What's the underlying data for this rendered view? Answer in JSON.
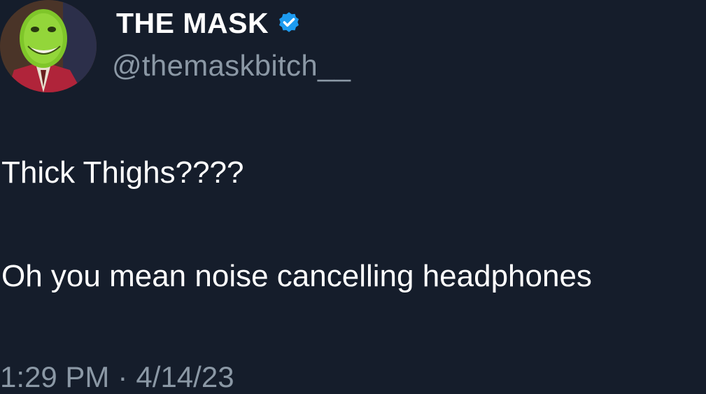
{
  "author": {
    "display_name": "THE MASK",
    "handle": "@themaskbitch__",
    "verified": true,
    "avatar": "the-mask-green-face-avatar"
  },
  "tweet": {
    "lines": [
      "Thick Thighs????",
      "Oh you mean noise cancelling headphones"
    ]
  },
  "meta": {
    "time": "1:29 PM",
    "separator": "·",
    "date": "4/14/23"
  },
  "colors": {
    "background": "#151d2b",
    "text": "#ffffff",
    "secondary_text": "#8b98a5",
    "verified_badge": "#1d9bf0"
  }
}
